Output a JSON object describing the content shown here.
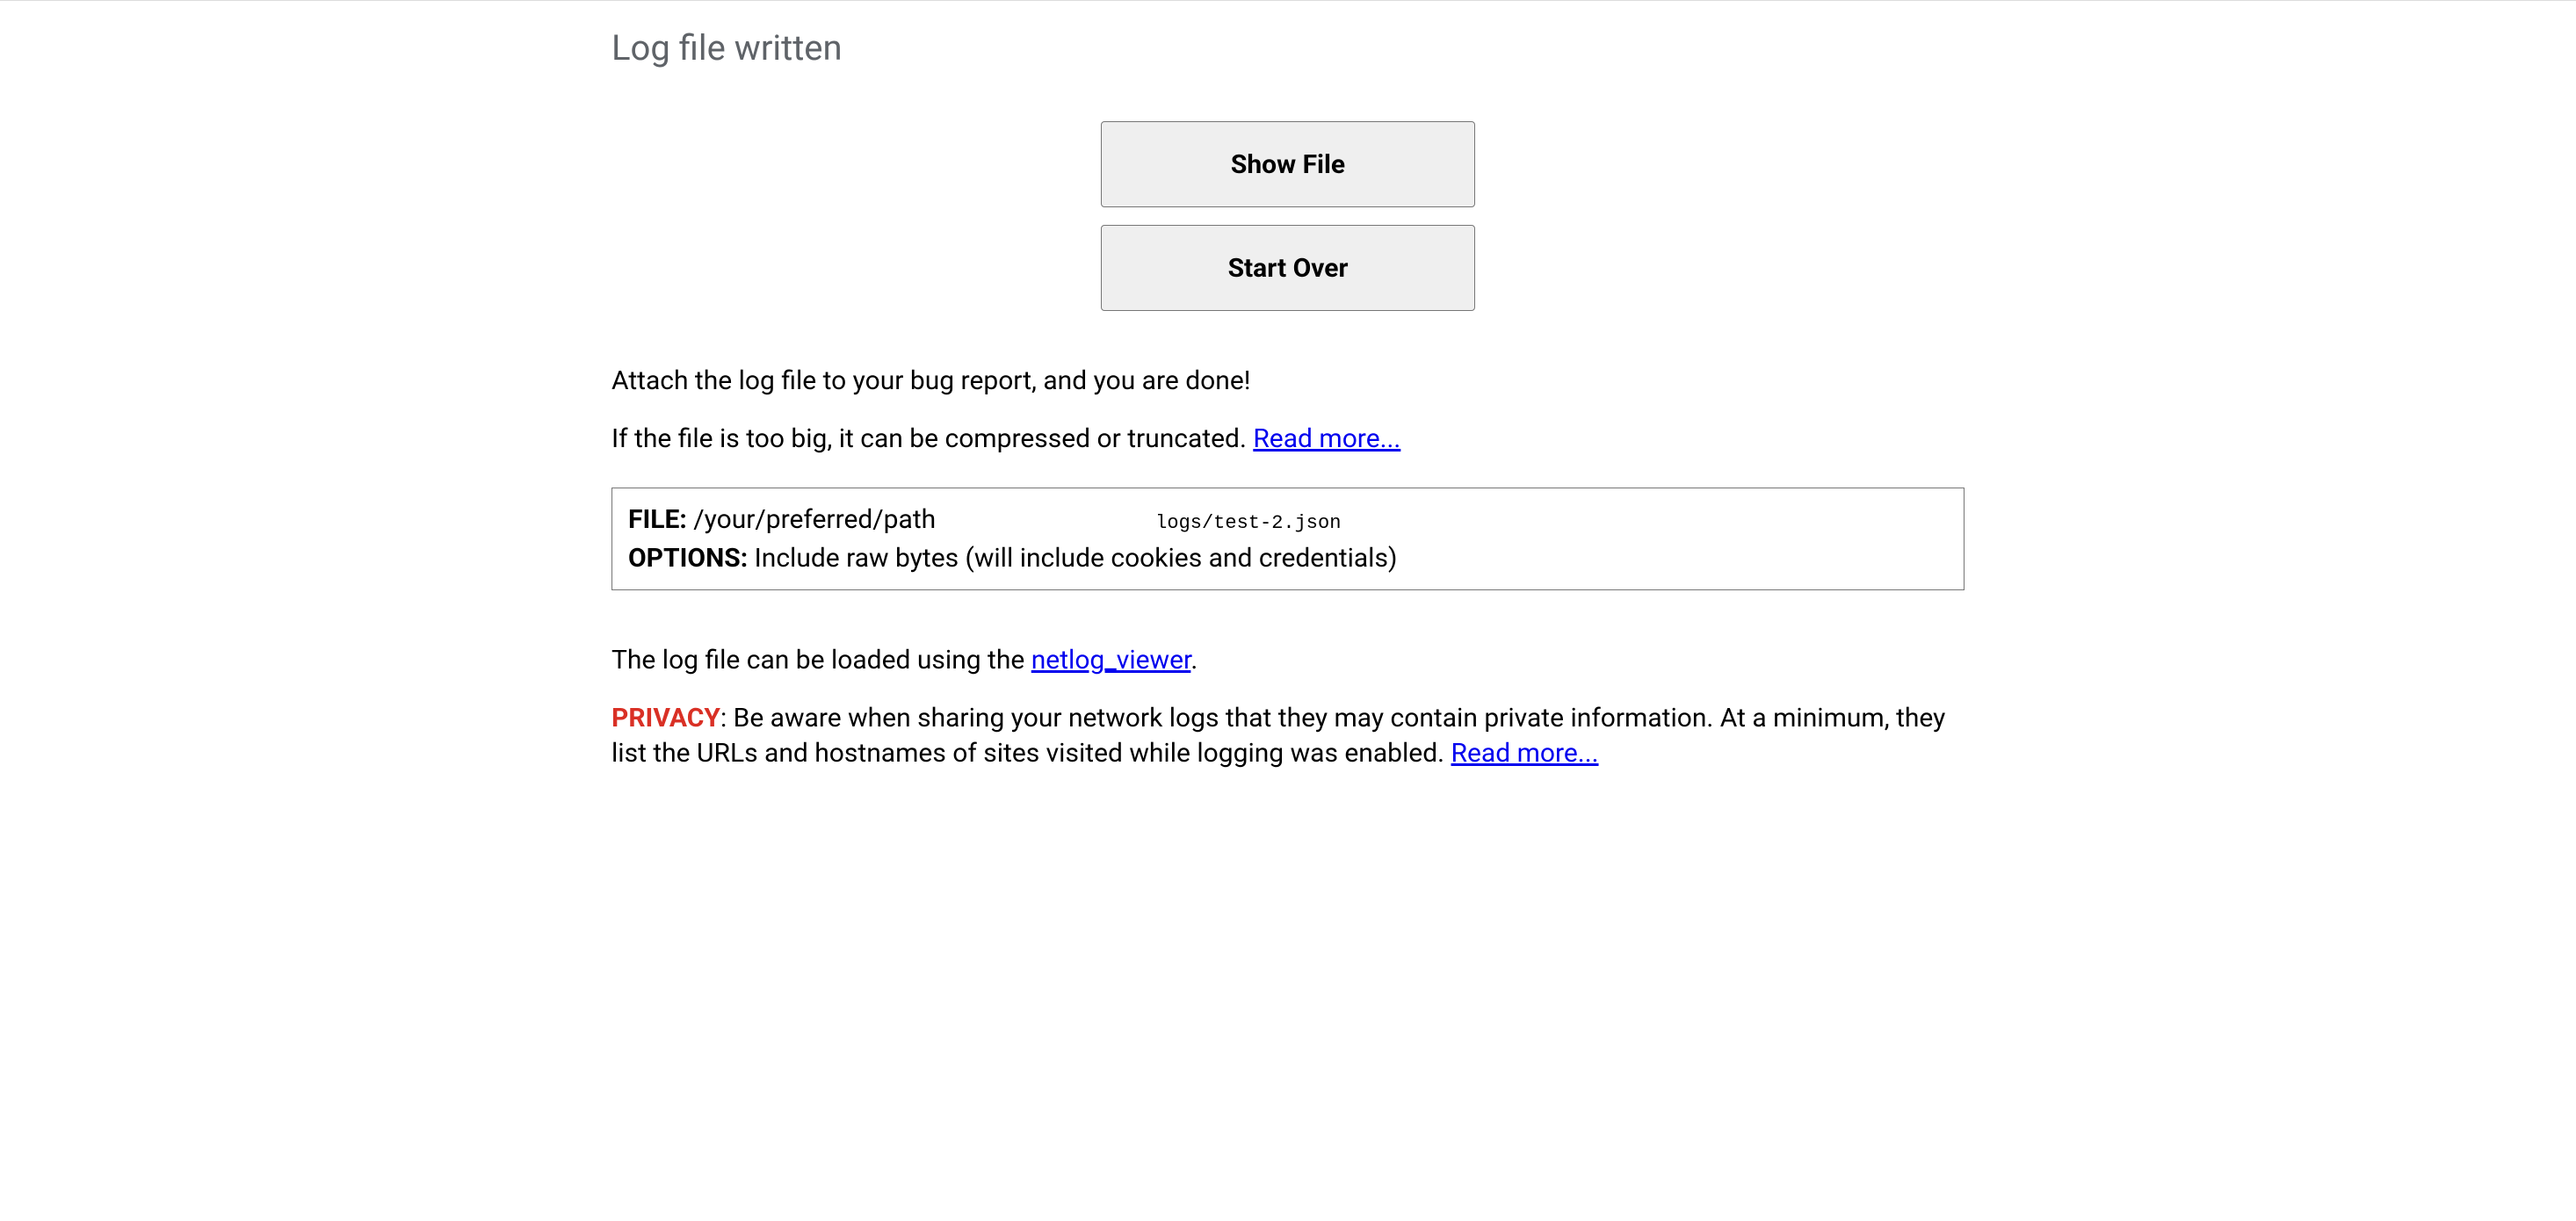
{
  "heading": "Log file written",
  "buttons": {
    "show_file": "Show File",
    "start_over": "Start Over"
  },
  "attach_text": "Attach the log file to your bug report, and you are done!",
  "too_big_text": "If the file is too big, it can be compressed or truncated. ",
  "read_more_link": "Read more...",
  "info_box": {
    "file_label": "FILE:",
    "file_path": " /your/preferred/path",
    "file_name": "logs/test-2.json",
    "options_label": "OPTIONS:",
    "options_value": " Include raw bytes (will include cookies and credentials)"
  },
  "loaded_text_prefix": "The log file can be loaded using the ",
  "netlog_viewer_link": "netlog_viewer",
  "loaded_text_suffix": ".",
  "privacy": {
    "label": "PRIVACY",
    "text": ": Be aware when sharing your network logs that they may contain private information. At a minimum, they list the URLs and hostnames of sites visited while logging was enabled. ",
    "read_more": "Read more..."
  }
}
